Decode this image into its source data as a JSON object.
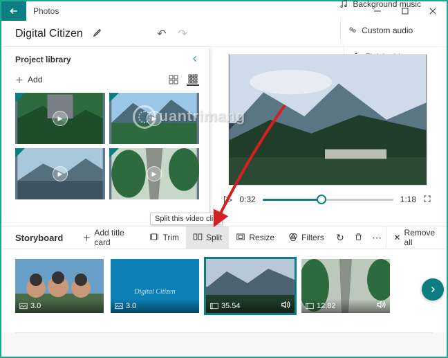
{
  "app": {
    "title": "Photos"
  },
  "project": {
    "name": "Digital Citizen"
  },
  "toolbar": {
    "bg_music": "Background music",
    "custom_audio": "Custom audio",
    "finish": "Finish video"
  },
  "library": {
    "title": "Project library",
    "add": "Add"
  },
  "playback": {
    "current": "0:32",
    "total": "1:18"
  },
  "storyboard": {
    "label": "Storyboard",
    "add_title": "Add title card",
    "trim": "Trim",
    "split": "Split",
    "resize": "Resize",
    "filters": "Filters",
    "remove_all": "Remove all",
    "tooltip": "Split this video clip"
  },
  "clips": [
    {
      "duration": "3.0",
      "audio": false,
      "type": "photo"
    },
    {
      "duration": "3.0",
      "audio": false,
      "type": "title",
      "caption": "Digital Citizen"
    },
    {
      "duration": "35.54",
      "audio": true,
      "type": "video"
    },
    {
      "duration": "12.82",
      "audio": true,
      "type": "video"
    }
  ],
  "watermark": "uantrimang"
}
